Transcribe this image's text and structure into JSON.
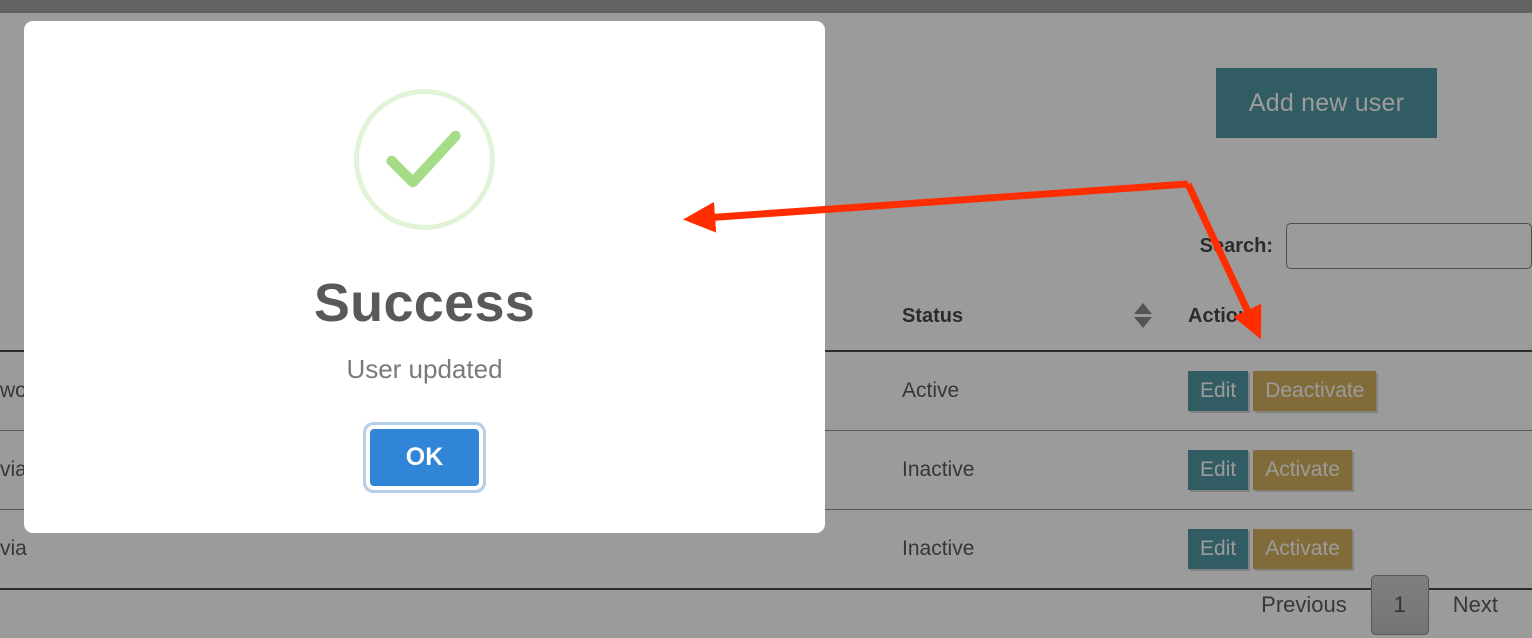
{
  "page": {
    "add_user_button": "Add new user",
    "search": {
      "label": "Search:",
      "value": "",
      "placeholder": ""
    },
    "table": {
      "headers": {
        "name": "",
        "status": "Status",
        "sort": "",
        "actions": "Actions"
      },
      "rows": [
        {
          "name": "wo",
          "status": "Active",
          "edit_label": "Edit",
          "toggle_label": "Deactivate"
        },
        {
          "name": "via",
          "status": "Inactive",
          "edit_label": "Edit",
          "toggle_label": "Activate"
        },
        {
          "name": "via",
          "status": "Inactive",
          "edit_label": "Edit",
          "toggle_label": "Activate"
        }
      ]
    },
    "pagination": {
      "previous": "Previous",
      "current_page": "1",
      "next": "Next"
    }
  },
  "modal": {
    "icon": "success-check-icon",
    "title": "Success",
    "message": "User updated",
    "confirm_label": "OK"
  },
  "annotations": {
    "arrow_1": "arrow-pointing-to-modal",
    "arrow_2": "arrow-pointing-to-deactivate-button"
  },
  "colors": {
    "overlay": "#4d4d4d",
    "topbar": "#818181",
    "teal_button": "#11707f",
    "gold_button": "#c4921e",
    "modal_confirm": "#3085d6",
    "success_green": "#a5dc86",
    "title_text": "#595959",
    "message_text": "#7a7a7a",
    "annotation_arrow": "#ff2d00"
  }
}
